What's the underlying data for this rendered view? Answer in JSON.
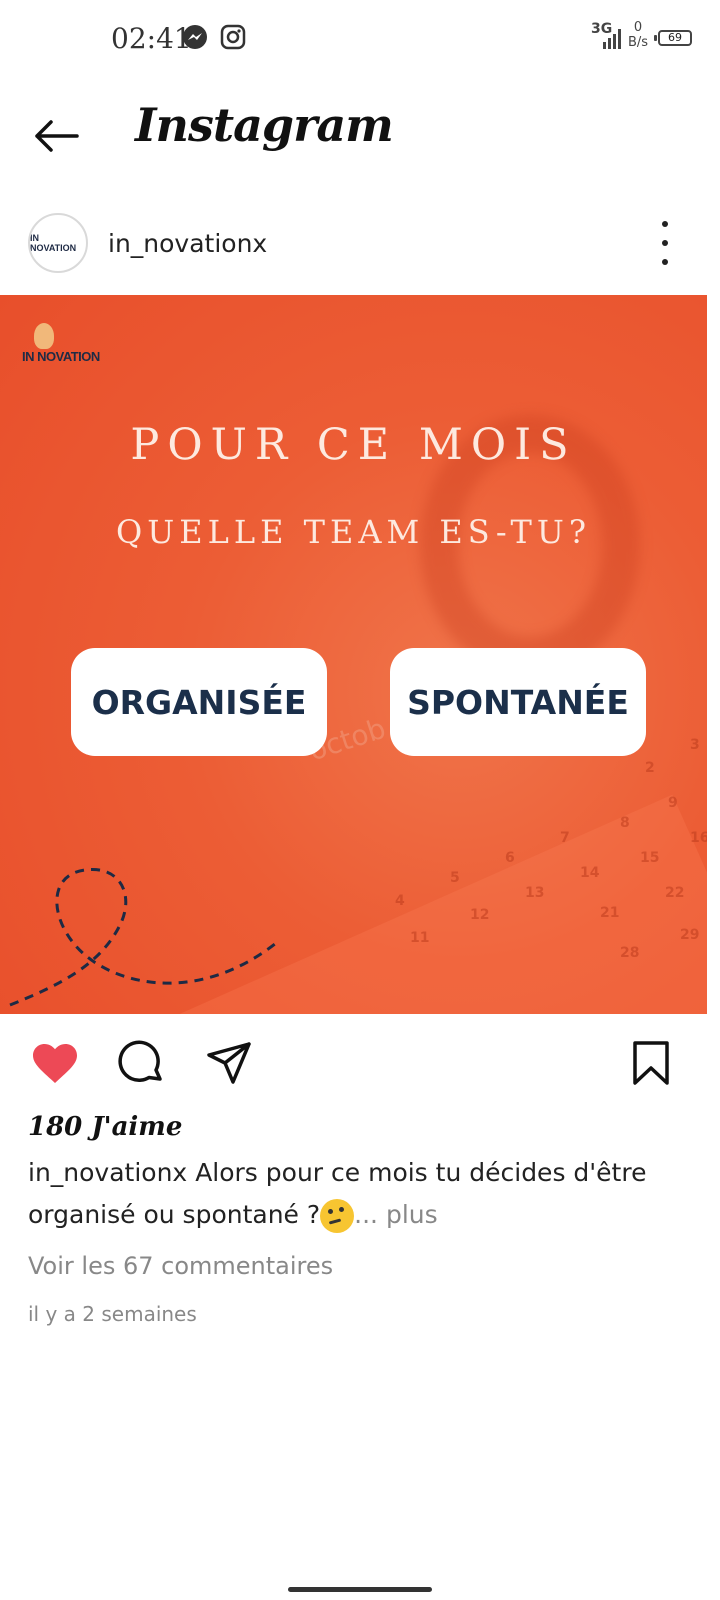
{
  "status_bar": {
    "time": "02:41",
    "network_type": "3G",
    "speed_value": "0",
    "speed_unit": "B/s",
    "battery": "69",
    "notification_icons": [
      "messenger-icon",
      "instagram-icon"
    ]
  },
  "header": {
    "title": "Instagram",
    "back_icon": "arrow-left-icon"
  },
  "post": {
    "username": "in_novationx",
    "image": {
      "brand_text": "IN NOVATION",
      "headline1": "POUR CE MOIS",
      "headline2": "QUELLE TEAM ES-TU?",
      "choices": [
        "ORGANISÉE",
        "SPONTANÉE"
      ],
      "calendar_text": "octob",
      "background_color": "#e9532c"
    },
    "likes": "180 J'aime",
    "caption_username": "in_novationx",
    "caption_text": "Alors pour ce mois tu décides d'être organisé ou spontané ?",
    "caption_emoji": "🤔",
    "caption_more": "... plus",
    "comments_link": "Voir les 67 commentaires",
    "timestamp": "il y a 2 semaines",
    "liked": true,
    "accent_like_color": "#ed4956"
  }
}
